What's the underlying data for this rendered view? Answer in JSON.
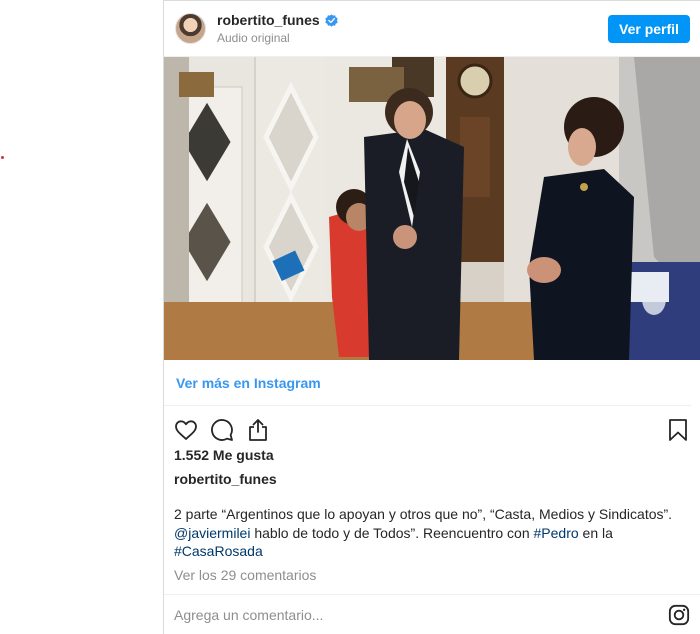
{
  "post": {
    "username": "robertito_funes",
    "audio": "Audio original",
    "view_profile": "Ver perfil",
    "see_more": "Ver más en Instagram",
    "likes": "1.552 Me gusta",
    "caption_author": "robertito_funes",
    "caption_part1": "2 parte “Argentinos que lo apoyan y otros que no”, “Casta, Medios y Sindicatos”.",
    "caption_mention": "@javiermilei",
    "caption_part2": " hablo de todo y de Todos”. Reencuentro con ",
    "caption_tag1": "#Pedro",
    "caption_part3": " en la",
    "caption_tag2": "#CasaRosada",
    "comments_link": "Ver los 29 comentarios",
    "comment_placeholder": "Agrega un comentario..."
  },
  "icons": {
    "avatar": "user-avatar",
    "verified": "verified-badge-icon",
    "like": "heart-icon",
    "comment": "comment-bubble-icon",
    "share": "share-icon",
    "save": "bookmark-icon",
    "instagram": "instagram-logo-icon"
  },
  "colors": {
    "accent": "#0095f6",
    "link": "#3897f0",
    "hashtag": "#00376b",
    "muted": "#8e8e8e"
  }
}
